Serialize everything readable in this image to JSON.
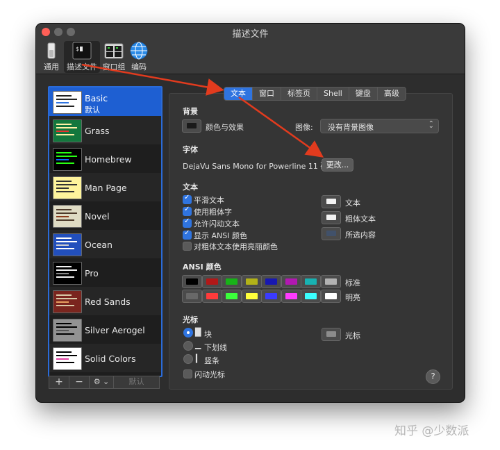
{
  "window": {
    "title": "描述文件"
  },
  "toolbar": [
    {
      "label": "通用",
      "icon": "switch-icon"
    },
    {
      "label": "描述文件",
      "icon": "terminal-icon"
    },
    {
      "label": "窗口组",
      "icon": "window-group-icon"
    },
    {
      "label": "编码",
      "icon": "globe-icon"
    }
  ],
  "profiles": [
    {
      "name": "Basic",
      "sub": "默认"
    },
    {
      "name": "Grass"
    },
    {
      "name": "Homebrew"
    },
    {
      "name": "Man Page"
    },
    {
      "name": "Novel"
    },
    {
      "name": "Ocean"
    },
    {
      "name": "Pro"
    },
    {
      "name": "Red Sands"
    },
    {
      "name": "Silver Aerogel"
    },
    {
      "name": "Solid Colors"
    }
  ],
  "list_buttons": {
    "add": "+",
    "remove": "−",
    "gear": "⚙ ⌄",
    "default": "默认"
  },
  "tabs": [
    "文本",
    "窗口",
    "标签页",
    "Shell",
    "键盘",
    "高级"
  ],
  "background": {
    "section": "背景",
    "color_label": "颜色与效果",
    "image_label": "图像:",
    "image_value": "没有背景图像"
  },
  "font": {
    "section": "字体",
    "name": "DejaVu Sans Mono for Powerline 11 磅",
    "change_button": "更改..."
  },
  "text": {
    "section": "文本",
    "options": [
      {
        "label": "平滑文本",
        "checked": true
      },
      {
        "label": "使用粗体字",
        "checked": true
      },
      {
        "label": "允许闪动文本",
        "checked": true
      },
      {
        "label": "显示 ANSI 颜色",
        "checked": true
      },
      {
        "label": "对粗体文本使用亮丽颜色",
        "checked": false
      }
    ],
    "color_labels": [
      "文本",
      "粗体文本",
      "所选内容"
    ]
  },
  "ansi": {
    "section": "ANSI 颜色",
    "normal_label": "标准",
    "bright_label": "明亮",
    "normal": [
      "#000000",
      "#b21818",
      "#18b218",
      "#b2b218",
      "#1818b2",
      "#b218b2",
      "#18b2b2",
      "#b2b2b2"
    ],
    "bright": [
      "#686868",
      "#ff3b3b",
      "#3bff3b",
      "#ffff3b",
      "#3b3bff",
      "#ff3bff",
      "#3bffff",
      "#ffffff"
    ]
  },
  "cursor": {
    "section": "光标",
    "options": [
      {
        "label": "块",
        "glyph": "█",
        "selected": true
      },
      {
        "label": "下划线",
        "glyph": "▁",
        "selected": false
      },
      {
        "label": "竖条",
        "glyph": "▎",
        "selected": false
      }
    ],
    "color_label": "光标",
    "blink_label": "闪动光标"
  },
  "help": "?",
  "watermark": "知乎 @少数派",
  "colors": {
    "accent": "#2f74e0",
    "selection": "#1e5fd2",
    "arrow": "#e23b1e"
  }
}
